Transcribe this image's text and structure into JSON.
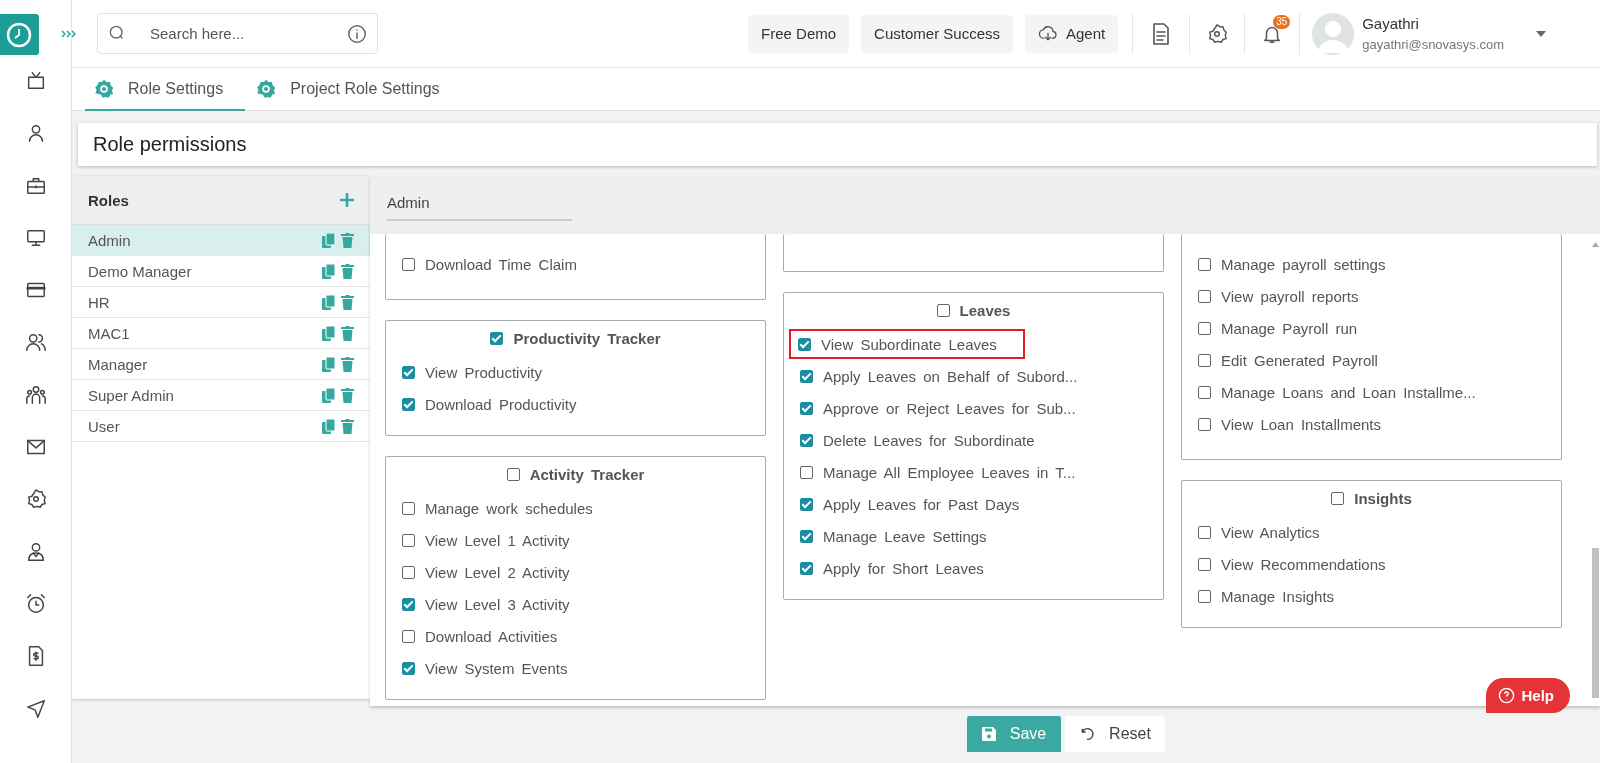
{
  "header": {
    "search": {
      "placeholder": "Search here..."
    },
    "buttons": [
      {
        "label": "Free Demo",
        "kind": "plain"
      },
      {
        "label": "Customer Success",
        "kind": "plain"
      },
      {
        "label": "Agent",
        "kind": "cloud"
      }
    ],
    "notification_count": "35",
    "user": {
      "name": "Gayathri",
      "email": "gayathri@snovasys.com"
    }
  },
  "tabs": [
    {
      "label": "Role Settings",
      "selected": true
    },
    {
      "label": "Project Role Settings",
      "selected": false
    }
  ],
  "page_title": "Role permissions",
  "roles": {
    "title": "Roles",
    "items": [
      {
        "name": "Admin",
        "selected": true
      },
      {
        "name": "Demo Manager",
        "selected": false
      },
      {
        "name": "HR",
        "selected": false
      },
      {
        "name": "MAC1",
        "selected": false
      },
      {
        "name": "Manager",
        "selected": false
      },
      {
        "name": "Super Admin",
        "selected": false
      },
      {
        "name": "User",
        "selected": false
      }
    ]
  },
  "role_field": {
    "value": "Admin"
  },
  "permission_columns": [
    [
      {
        "kind": "partial",
        "items": [
          {
            "label": "Download Time Claim",
            "checked": false,
            "highlighted": false
          }
        ]
      },
      {
        "kind": "section",
        "title": "Productivity Tracker",
        "checked": true,
        "items": [
          {
            "label": "View Productivity",
            "checked": true,
            "highlighted": false
          },
          {
            "label": "Download Productivity",
            "checked": true,
            "highlighted": false
          }
        ]
      },
      {
        "kind": "section",
        "title": "Activity Tracker",
        "checked": false,
        "items": [
          {
            "label": "Manage work schedules",
            "checked": false,
            "highlighted": false
          },
          {
            "label": "View Level 1 Activity",
            "checked": false,
            "highlighted": false
          },
          {
            "label": "View Level 2 Activity",
            "checked": false,
            "highlighted": false
          },
          {
            "label": "View Level 3 Activity",
            "checked": true,
            "highlighted": false
          },
          {
            "label": "Download Activities",
            "checked": false,
            "highlighted": false
          },
          {
            "label": "View System Events",
            "checked": true,
            "highlighted": false
          }
        ]
      }
    ],
    [
      {
        "kind": "partial"
      },
      {
        "kind": "section",
        "title": "Leaves",
        "checked": false,
        "items": [
          {
            "label": "View Subordinate Leaves",
            "checked": true,
            "highlighted": true
          },
          {
            "label": "Apply Leaves on Behalf of Subord...",
            "checked": true,
            "highlighted": false
          },
          {
            "label": "Approve or Reject Leaves for Sub...",
            "checked": true,
            "highlighted": false
          },
          {
            "label": "Delete Leaves for Subordinate",
            "checked": true,
            "highlighted": false
          },
          {
            "label": "Manage All Employee Leaves in T...",
            "checked": false,
            "highlighted": false
          },
          {
            "label": "Apply Leaves for Past Days",
            "checked": true,
            "highlighted": false
          },
          {
            "label": "Manage Leave Settings",
            "checked": true,
            "highlighted": false
          },
          {
            "label": "Apply for Short Leaves",
            "checked": true,
            "highlighted": false
          }
        ]
      }
    ],
    [
      {
        "kind": "partial",
        "items": [
          {
            "label": "Manage payroll settings",
            "checked": false,
            "highlighted": false
          },
          {
            "label": "View payroll reports",
            "checked": false,
            "highlighted": false
          },
          {
            "label": "Manage Payroll run",
            "checked": false,
            "highlighted": false
          },
          {
            "label": "Edit Generated Payroll",
            "checked": false,
            "highlighted": false
          },
          {
            "label": "Manage Loans and Loan Installme...",
            "checked": false,
            "highlighted": false
          },
          {
            "label": "View Loan Installments",
            "checked": false,
            "highlighted": false
          }
        ]
      },
      {
        "kind": "section",
        "title": "Insights",
        "checked": false,
        "items": [
          {
            "label": "View Analytics",
            "checked": false,
            "highlighted": false
          },
          {
            "label": "View Recommendations",
            "checked": false,
            "highlighted": false
          },
          {
            "label": "Manage Insights",
            "checked": false,
            "highlighted": false
          }
        ]
      }
    ]
  ],
  "help": {
    "label": "Help"
  },
  "actions": [
    {
      "label": "Save",
      "kind": "save"
    },
    {
      "label": "Reset",
      "kind": "reset"
    }
  ]
}
